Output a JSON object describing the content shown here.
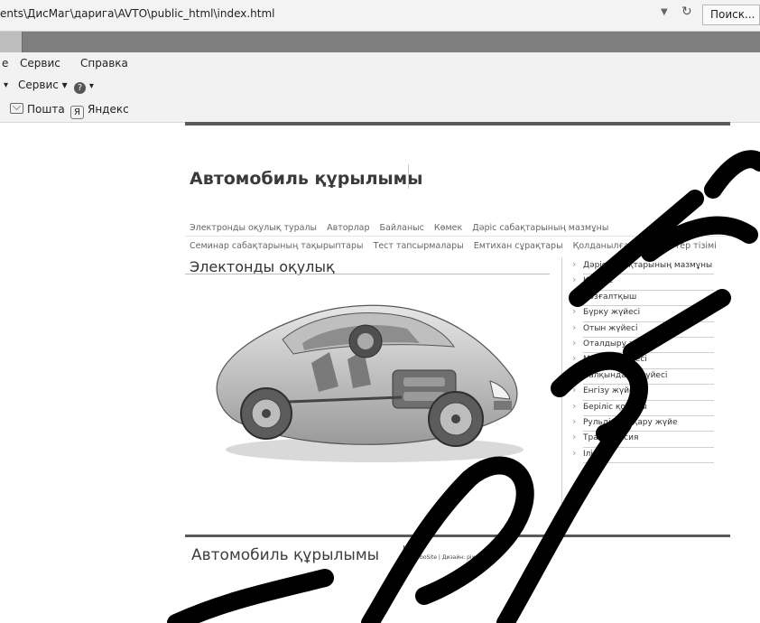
{
  "browser": {
    "url": "ents\\ДисМаг\\дарига\\AVTO\\public_html\\index.html",
    "search_label": "Поиск...",
    "menu": [
      "е",
      "Сервис",
      "Справка"
    ],
    "command": {
      "first_arrow": "▾",
      "service": "Сервис ▾",
      "help_arrow": "▾",
      "help_glyph": "?"
    },
    "favorites": [
      "Пошта",
      "Яндекс"
    ],
    "yandex_glyph": "Я"
  },
  "site": {
    "title": "Автомобиль құрылымы",
    "nav_row1": [
      "Электронды оқулық туралы",
      "Авторлар",
      "Байланыс",
      "Көмек",
      "Дәріс сабақтарының мазмұны"
    ],
    "nav_row2": [
      "Семинар сабақтарының тақырыптары",
      "Тест тапсырмалары",
      "Емтихан сұрақтары",
      "Қолданылған әдебиеттер тізімі"
    ],
    "content_title": "Электонды оқулық",
    "sidebar_items": [
      "Дәріс сабақтарының мазмұны",
      "Кіріспе",
      "Қозғалтқыш",
      "Бүрку жүйесі",
      "Отын жүйесі",
      "Оталдыру жүйесі",
      "Майлау жүйесі",
      "Салқындату жүйесі",
      "Енгізу жүйесі",
      "Беріліс қорабы",
      "Рульдік басқару жүйе",
      "Трансмиссия",
      "Ілінісу"
    ],
    "footer_title": "Автомобиль құрылымы",
    "footer_credit": "TurboSite | Дизайн: pixelStudio"
  }
}
